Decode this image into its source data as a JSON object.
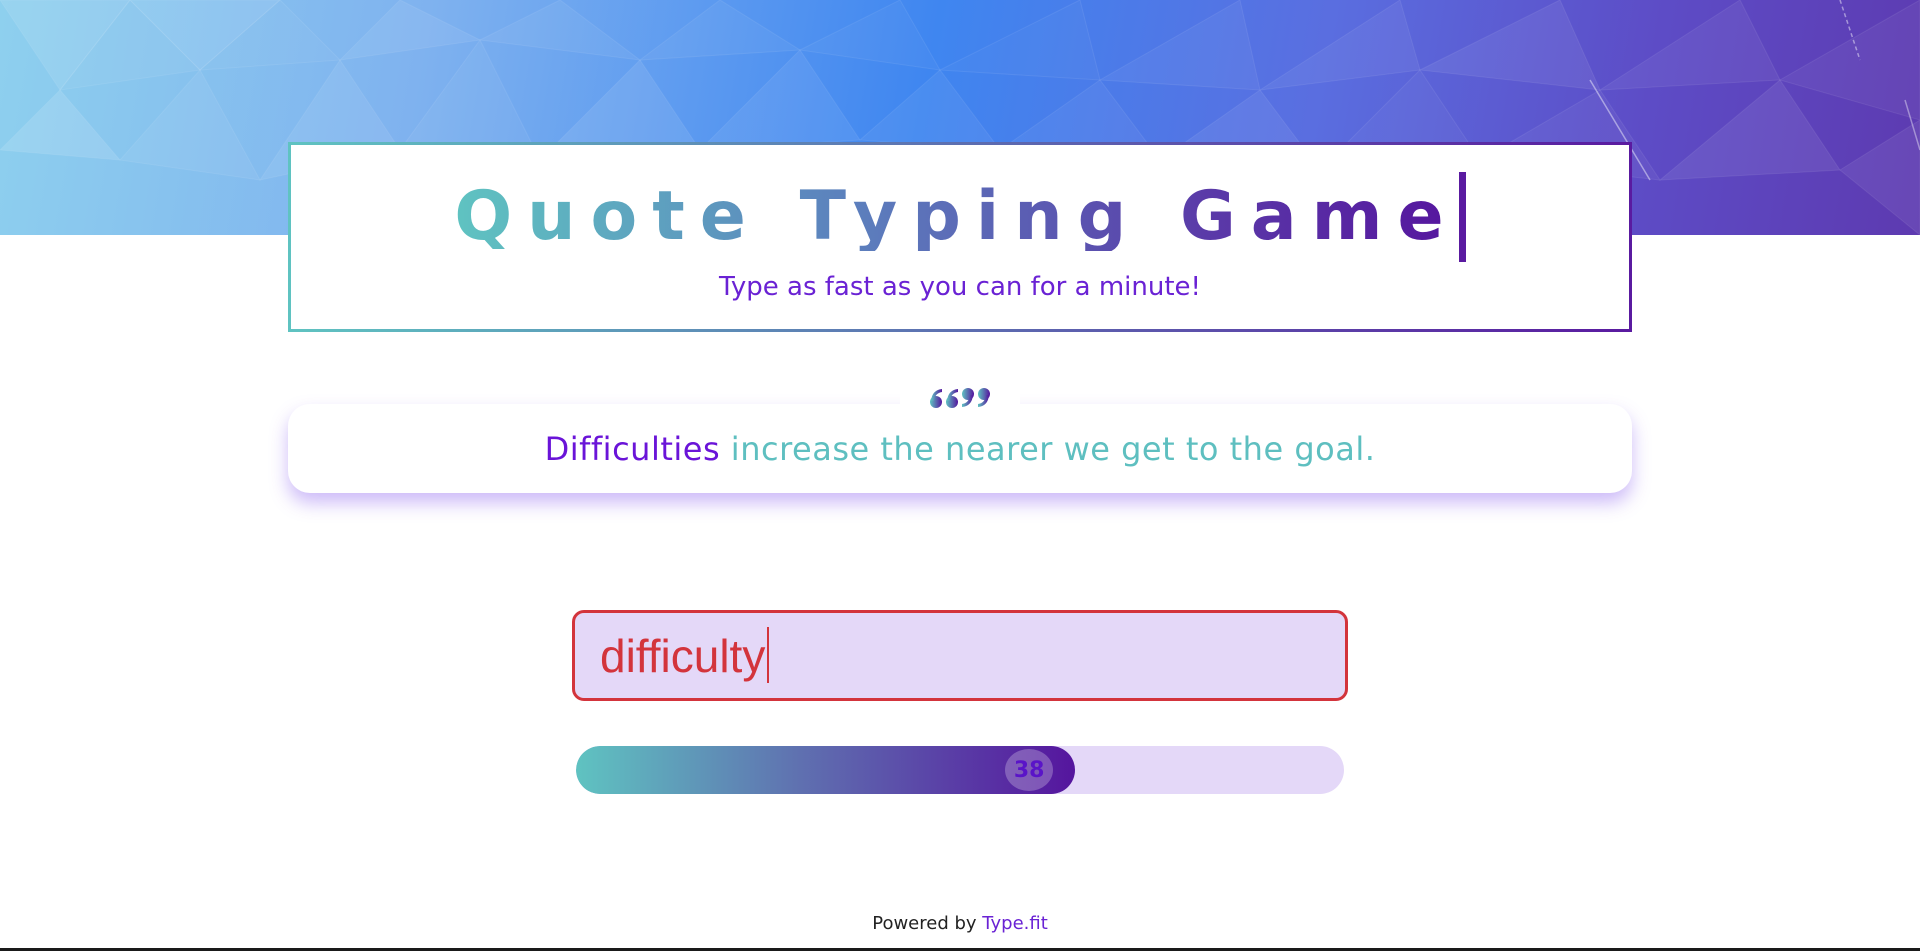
{
  "header": {
    "title": "Quote Typing Game",
    "subtitle": "Type as fast as you can for a minute!"
  },
  "quote": {
    "icon": "quote-marks-icon",
    "current_word": "Difficulties",
    "remaining_text": "increase the nearer we get to the goal."
  },
  "input": {
    "value": "difficulty",
    "state": "error"
  },
  "timer": {
    "seconds_left": "38",
    "progress_percent": 65
  },
  "footer": {
    "prefix": "Powered by",
    "link_label": "Type.fit"
  },
  "colors": {
    "accent_teal": "#5fc3c1",
    "accent_purple": "#55159e",
    "error_red": "#d3343c",
    "input_bg": "#e4d8f8"
  }
}
